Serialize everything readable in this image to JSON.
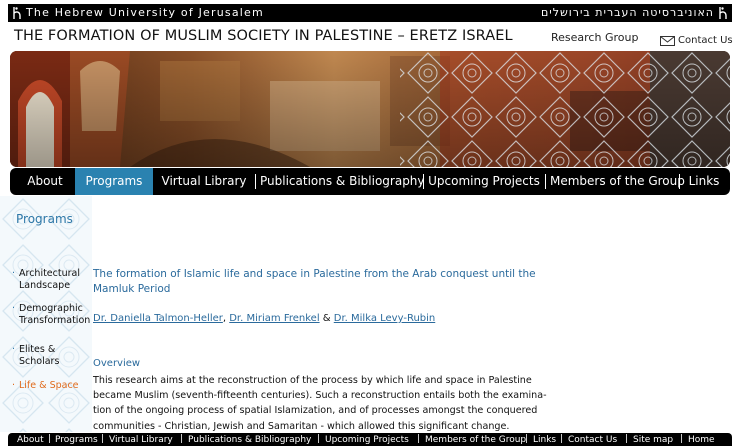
{
  "university_bar": {
    "english": "The Hebrew University of Jerusalem",
    "hebrew": "האוניברסיטה העברית בירושלים"
  },
  "header": {
    "title": "THE FORMATION OF MUSLIM SOCIETY IN PALESTINE – ERETZ ISRAEL",
    "research_group": "Research Group",
    "contact_label": "Contact Us"
  },
  "main_nav": {
    "items": [
      {
        "label": "About"
      },
      {
        "label": "Programs",
        "active": true
      },
      {
        "label": "Virtual Library"
      },
      {
        "label": "Publications & Bibliography"
      },
      {
        "label": "Upcoming Projects"
      },
      {
        "label": "Members of the Group"
      },
      {
        "label": "Links"
      }
    ],
    "active_color": "#2a82b0"
  },
  "sidebar": {
    "heading": "Programs",
    "items": [
      {
        "label": "Architectural Landscape"
      },
      {
        "label": "Demographic Transformation"
      },
      {
        "label": "Elites & Scholars"
      },
      {
        "label": "Life & Space",
        "active": true
      }
    ],
    "active_color": "#e06b1c"
  },
  "content": {
    "title": "The formation of Islamic life and space in Palestine from the Arab conquest until the Mamluk Period",
    "authors": [
      "Dr. Daniella Talmon-Heller",
      "Dr.  Miriam Frenkel",
      "Dr. Milka Levy-Rubin"
    ],
    "author_sep_1": ", ",
    "author_sep_2": " & ",
    "overview_label": "Overview",
    "overview_lines": [
      "This research aims at the reconstruction of the process by which life and space in Palestine",
      "became Muslim (seventh-fifteenth centuries). Such a reconstruction entails both the examina-",
      "tion of the ongoing process of spatial Islamization, and of processes amongst the conquered",
      "communities - Christian, Jewish and Samaritan - which allowed this significant change."
    ]
  },
  "footer_nav": {
    "items": [
      "About",
      "Programs",
      "Virtual Library",
      "Publications & Bibliography",
      "Upcoming Projects",
      "Members of the Group",
      "Links",
      "Contact Us",
      "Site map",
      "Home"
    ],
    "separator": "|"
  },
  "icons": {
    "contact": "envelope-icon",
    "university_logo": "university-logo-icon"
  },
  "colors": {
    "link_blue": "#2a6a9c",
    "heading_blue": "#2e78a8",
    "active_orange": "#e06b1c"
  }
}
